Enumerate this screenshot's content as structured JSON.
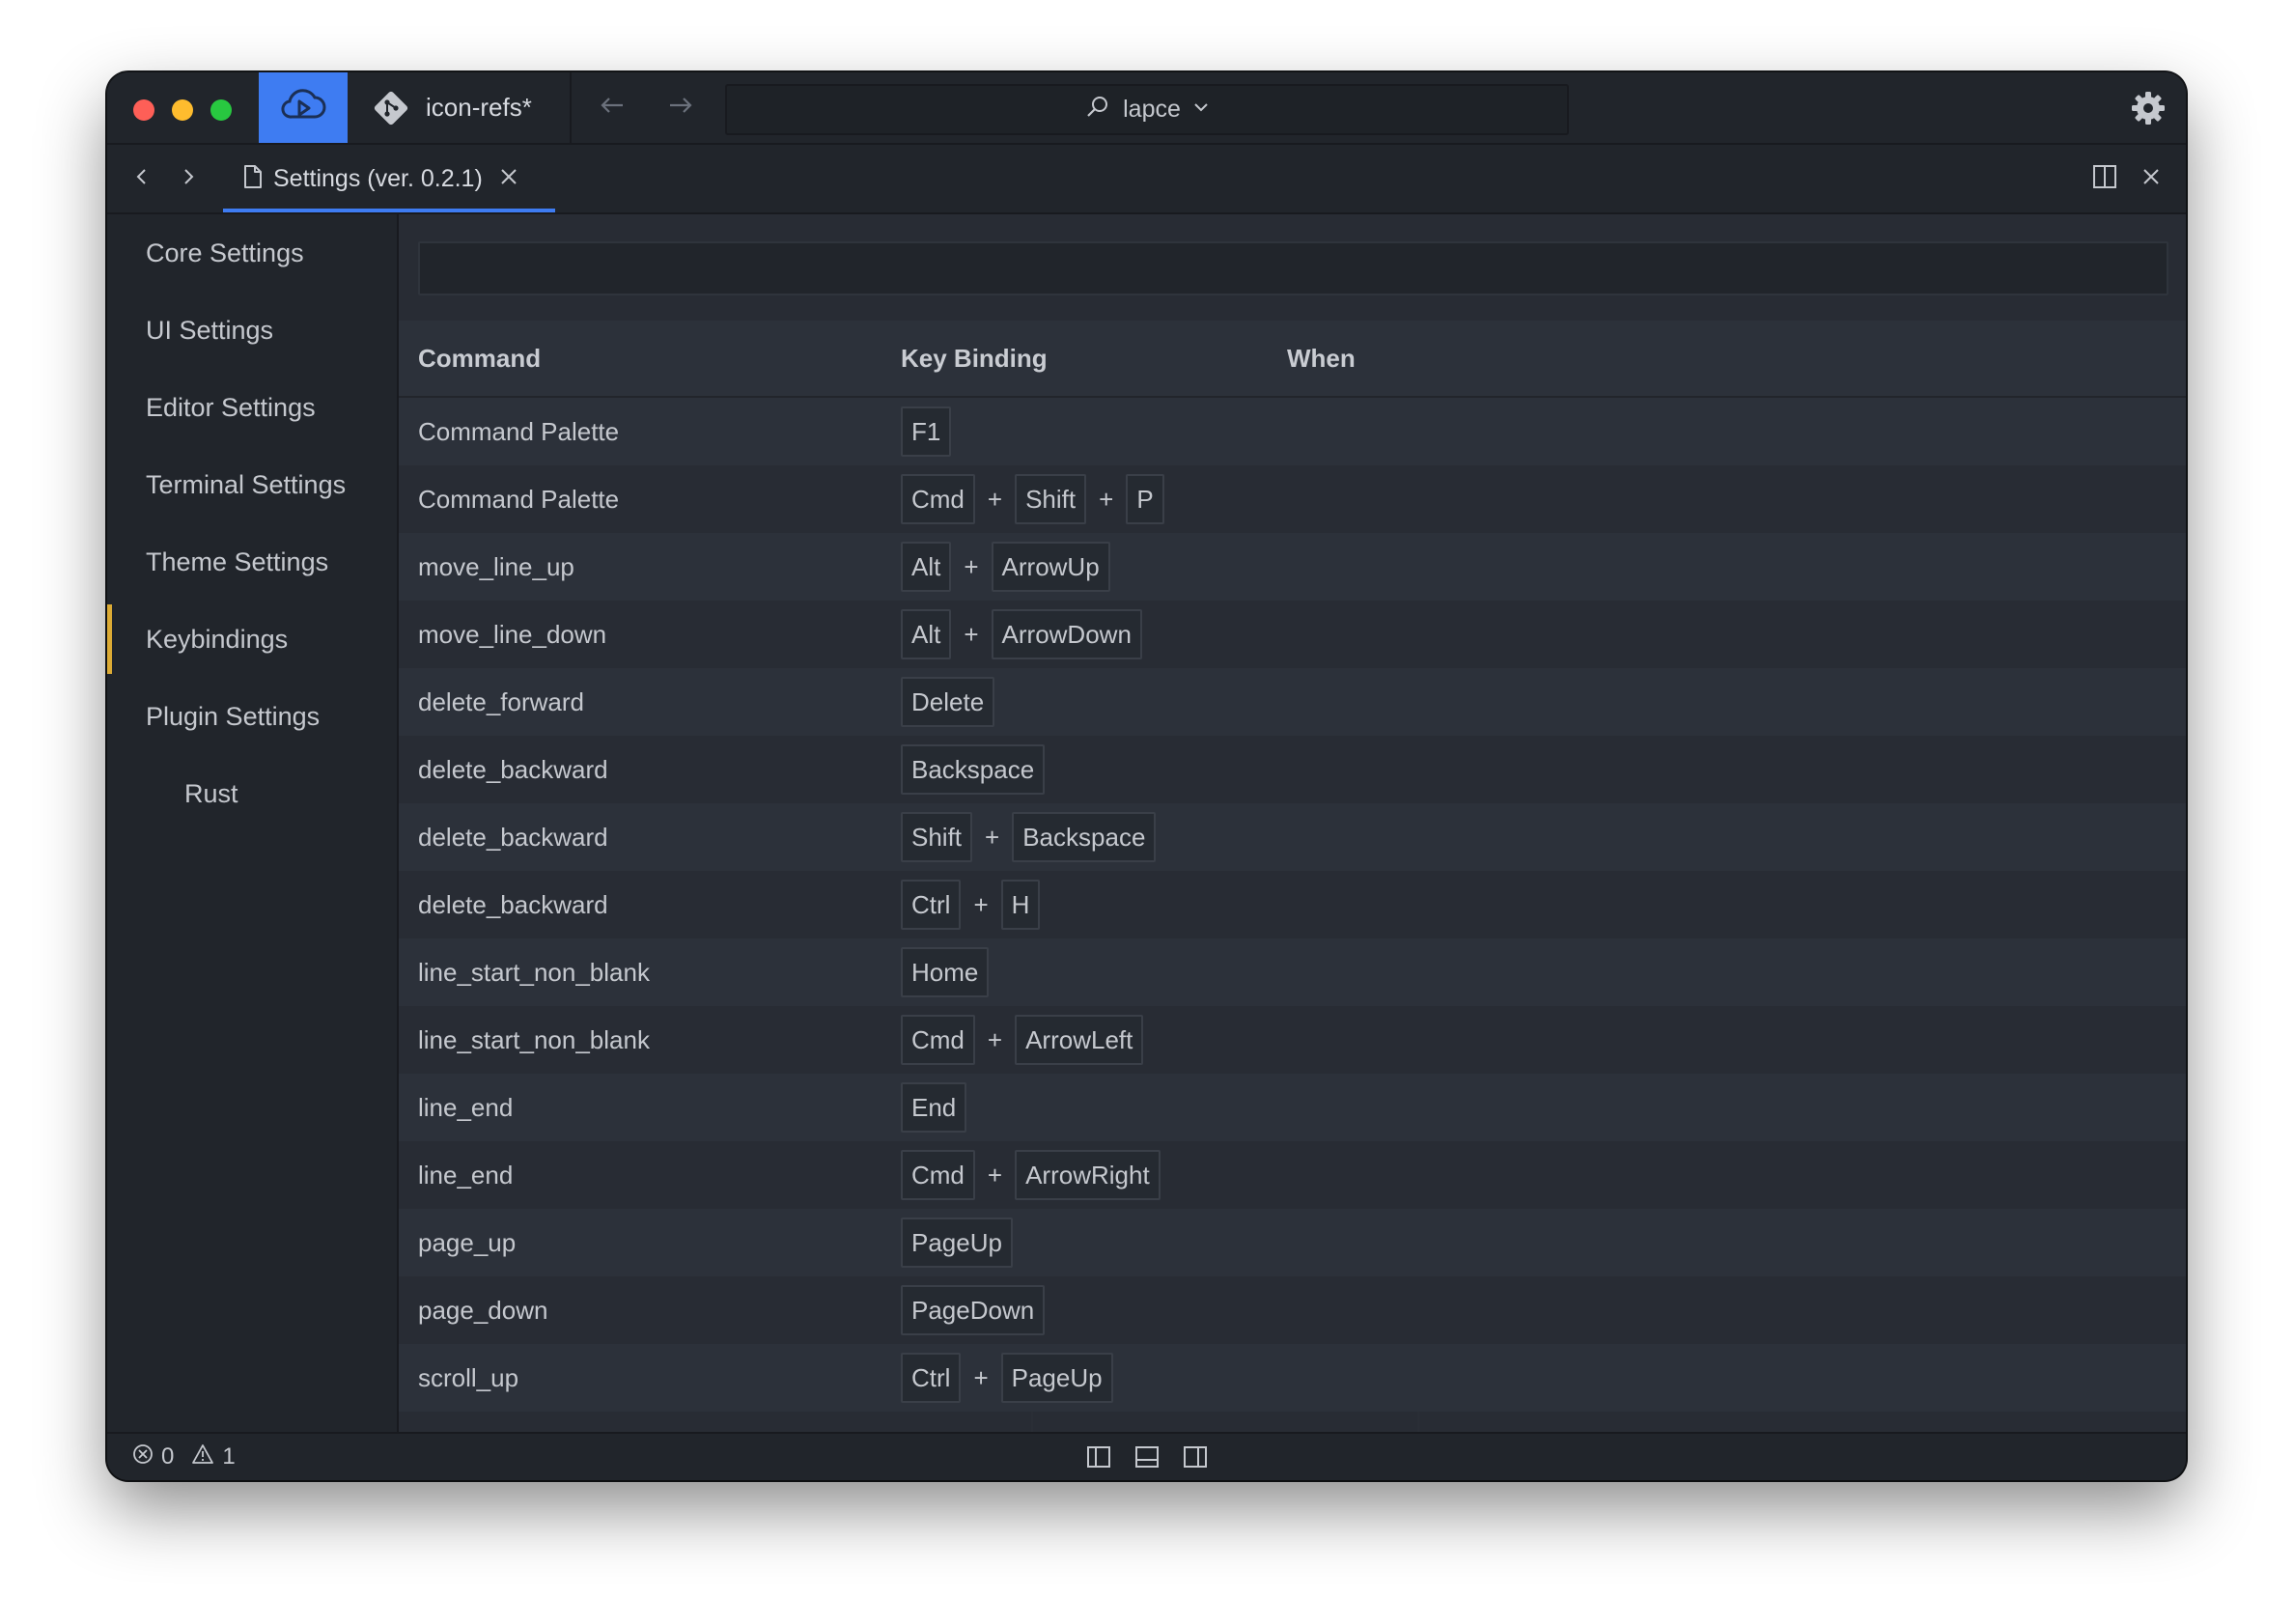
{
  "titlebar": {
    "branch_name": "icon-refs*",
    "workspace_name": "lapce",
    "icons": {
      "remote": "remote-cloud-icon",
      "branch": "git-branch-icon",
      "back": "arrow-left-icon",
      "forward": "arrow-right-icon",
      "search": "search-icon",
      "workspace_dropdown": "chevron-down-icon",
      "settings": "gear-icon"
    }
  },
  "tabbar": {
    "tab_title": "Settings (ver. 0.2.1)",
    "icons": [
      "chevron-left-icon",
      "chevron-right-icon",
      "file-icon",
      "close-icon",
      "split-editor-icon",
      "close-editor-icon"
    ]
  },
  "sidebar": {
    "items": [
      {
        "label": "Core Settings"
      },
      {
        "label": "UI Settings"
      },
      {
        "label": "Editor Settings"
      },
      {
        "label": "Terminal Settings"
      },
      {
        "label": "Theme Settings"
      },
      {
        "label": "Keybindings",
        "active": true
      },
      {
        "label": "Plugin Settings"
      },
      {
        "label": "Rust",
        "sub": true
      }
    ]
  },
  "table": {
    "headers": {
      "command": "Command",
      "key_binding": "Key Binding",
      "when": "When"
    },
    "rows": [
      {
        "command": "Command Palette",
        "keys": [
          "F1"
        ]
      },
      {
        "command": "Command Palette",
        "keys": [
          "Cmd",
          "Shift",
          "P"
        ]
      },
      {
        "command": "move_line_up",
        "keys": [
          "Alt",
          "ArrowUp"
        ]
      },
      {
        "command": "move_line_down",
        "keys": [
          "Alt",
          "ArrowDown"
        ]
      },
      {
        "command": "delete_forward",
        "keys": [
          "Delete"
        ]
      },
      {
        "command": "delete_backward",
        "keys": [
          "Backspace"
        ]
      },
      {
        "command": "delete_backward",
        "keys": [
          "Shift",
          "Backspace"
        ]
      },
      {
        "command": "delete_backward",
        "keys": [
          "Ctrl",
          "H"
        ]
      },
      {
        "command": "line_start_non_blank",
        "keys": [
          "Home"
        ]
      },
      {
        "command": "line_start_non_blank",
        "keys": [
          "Cmd",
          "ArrowLeft"
        ]
      },
      {
        "command": "line_end",
        "keys": [
          "End"
        ]
      },
      {
        "command": "line_end",
        "keys": [
          "Cmd",
          "ArrowRight"
        ]
      },
      {
        "command": "page_up",
        "keys": [
          "PageUp"
        ]
      },
      {
        "command": "page_down",
        "keys": [
          "PageDown"
        ]
      },
      {
        "command": "scroll_up",
        "keys": [
          "Ctrl",
          "PageUp"
        ]
      }
    ],
    "plus_sign": "+"
  },
  "statusbar": {
    "error_count": "0",
    "warning_count": "1",
    "icons": [
      "error-icon",
      "warning-icon",
      "toggle-left-panel-icon",
      "toggle-bottom-panel-icon",
      "toggle-right-panel-icon"
    ]
  },
  "colors": {
    "accent": "#3e7cf2",
    "active_indicator": "#dcab35",
    "close_light": "#fe5f57",
    "minimize_light": "#febc2e",
    "zoom_light": "#28c840"
  }
}
